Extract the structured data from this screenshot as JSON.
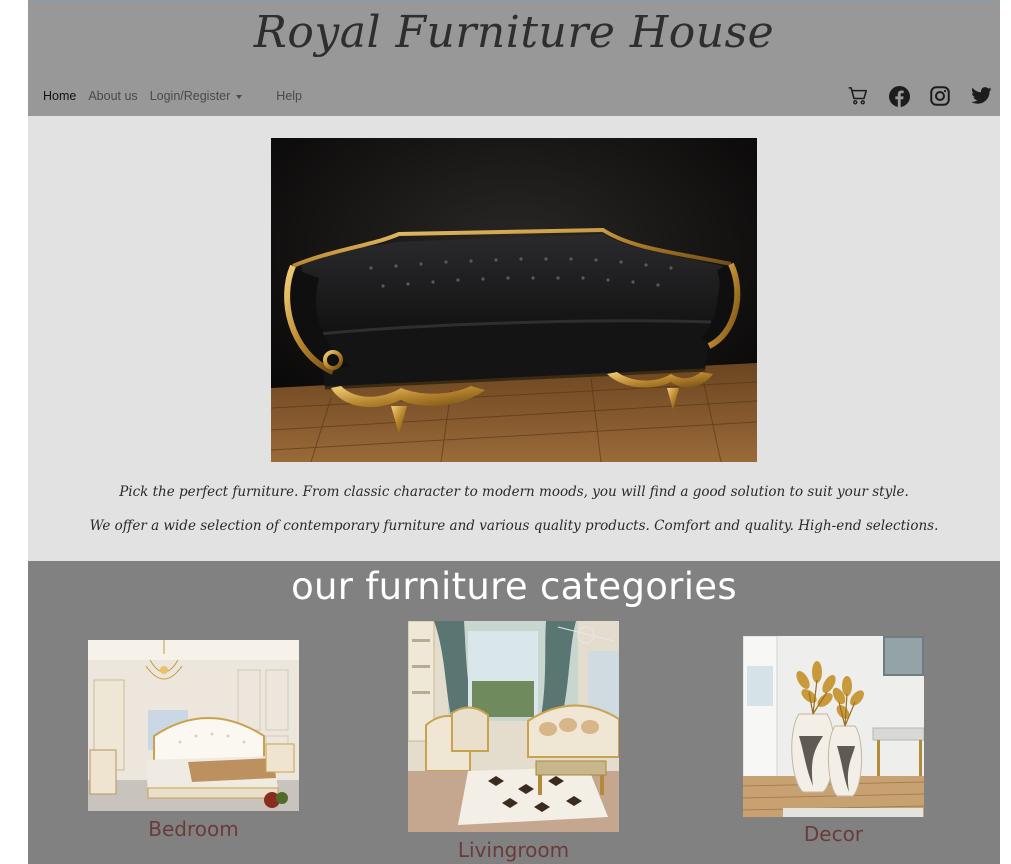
{
  "header": {
    "brand": "Royal Furniture House",
    "nav": {
      "home": "Home",
      "about": "About us",
      "login": "Login/Register",
      "help": "Help"
    },
    "icons": [
      "cart-icon",
      "facebook-icon",
      "instagram-icon",
      "twitter-icon"
    ]
  },
  "hero": {
    "image": "black-gold-baroque-sofa",
    "line1": "Pick the perfect furniture. From classic character to modern moods, you will find a good solution to suit your style.",
    "line2": "We offer a wide selection of contemporary furniture and various quality products. Comfort and quality. High-end selections."
  },
  "categories": {
    "title": "our furniture categories",
    "items": [
      {
        "label": "Bedroom",
        "image": "bedroom-photo"
      },
      {
        "label": "Livingroom",
        "image": "livingroom-photo"
      },
      {
        "label": "Decor",
        "image": "decor-vases-photo"
      }
    ]
  },
  "colors": {
    "header_bg": "#989898",
    "page_bg": "#e2e2e2",
    "categories_bg": "#818181",
    "category_label": "#6a3b3b"
  }
}
